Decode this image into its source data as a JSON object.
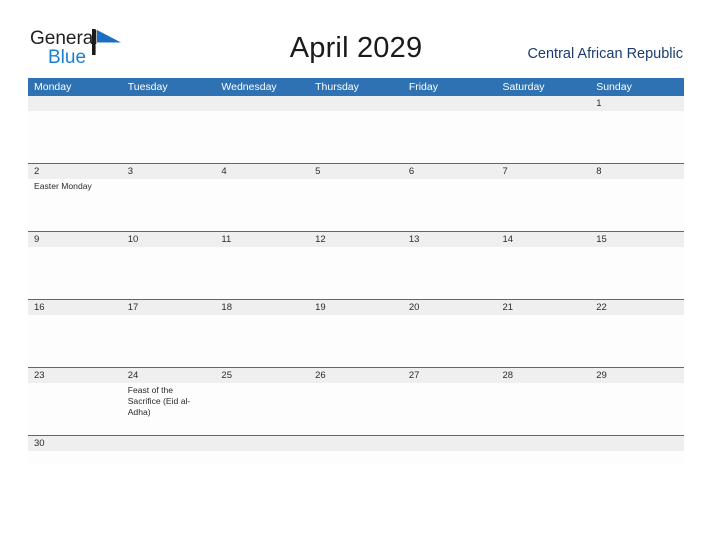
{
  "branding": {
    "logo_text_primary": "General",
    "logo_text_secondary": "Blue",
    "logo_mark": "triangle-flag-icon",
    "accent_blue": "#2f72b3",
    "logo_blue": "#1b7fd0"
  },
  "header": {
    "month_title": "April 2029",
    "country": "Central African Republic"
  },
  "calendar": {
    "weekday_headers": [
      "Monday",
      "Tuesday",
      "Wednesday",
      "Thursday",
      "Friday",
      "Saturday",
      "Sunday"
    ],
    "weeks": [
      {
        "height": "tall",
        "days": [
          {
            "date": "",
            "event": ""
          },
          {
            "date": "",
            "event": ""
          },
          {
            "date": "",
            "event": ""
          },
          {
            "date": "",
            "event": ""
          },
          {
            "date": "",
            "event": ""
          },
          {
            "date": "",
            "event": ""
          },
          {
            "date": "1",
            "event": ""
          }
        ]
      },
      {
        "height": "tall",
        "days": [
          {
            "date": "2",
            "event": "Easter Monday"
          },
          {
            "date": "3",
            "event": ""
          },
          {
            "date": "4",
            "event": ""
          },
          {
            "date": "5",
            "event": ""
          },
          {
            "date": "6",
            "event": ""
          },
          {
            "date": "7",
            "event": ""
          },
          {
            "date": "8",
            "event": ""
          }
        ]
      },
      {
        "height": "tall",
        "days": [
          {
            "date": "9",
            "event": ""
          },
          {
            "date": "10",
            "event": ""
          },
          {
            "date": "11",
            "event": ""
          },
          {
            "date": "12",
            "event": ""
          },
          {
            "date": "13",
            "event": ""
          },
          {
            "date": "14",
            "event": ""
          },
          {
            "date": "15",
            "event": ""
          }
        ]
      },
      {
        "height": "tall",
        "days": [
          {
            "date": "16",
            "event": ""
          },
          {
            "date": "17",
            "event": ""
          },
          {
            "date": "18",
            "event": ""
          },
          {
            "date": "19",
            "event": ""
          },
          {
            "date": "20",
            "event": ""
          },
          {
            "date": "21",
            "event": ""
          },
          {
            "date": "22",
            "event": ""
          }
        ]
      },
      {
        "height": "tall",
        "days": [
          {
            "date": "23",
            "event": ""
          },
          {
            "date": "24",
            "event": "Feast of the Sacrifice (Eid al-Adha)"
          },
          {
            "date": "25",
            "event": ""
          },
          {
            "date": "26",
            "event": ""
          },
          {
            "date": "27",
            "event": ""
          },
          {
            "date": "28",
            "event": ""
          },
          {
            "date": "29",
            "event": ""
          }
        ]
      },
      {
        "height": "short",
        "days": [
          {
            "date": "30",
            "event": ""
          },
          {
            "date": "",
            "event": ""
          },
          {
            "date": "",
            "event": ""
          },
          {
            "date": "",
            "event": ""
          },
          {
            "date": "",
            "event": ""
          },
          {
            "date": "",
            "event": ""
          },
          {
            "date": "",
            "event": ""
          }
        ]
      }
    ]
  }
}
